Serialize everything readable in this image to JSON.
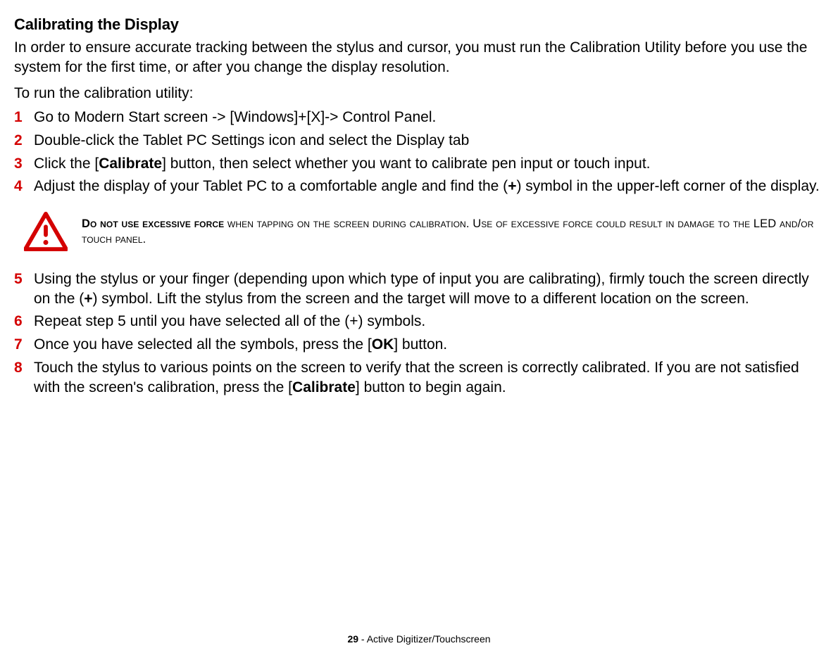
{
  "heading": "Calibrating the Display",
  "intro": "In order to ensure accurate tracking between the stylus and cursor, you must run the Calibration Utility before you use the system for the first time, or after you change the display resolution.",
  "lead": "To run the calibration utility:",
  "stepsA": {
    "n1": "1",
    "s1": "Go to Modern Start screen -> [Windows]+[X]-> Control Panel.",
    "n2": "2",
    "s2": "Double-click the Tablet PC Settings icon and select the Display tab",
    "n3": "3",
    "s3a": "Click the [",
    "s3b": "Calibrate",
    "s3c": "] button, then select whether you want to calibrate pen input or touch input.",
    "n4": "4",
    "s4a": "Adjust the display of your Tablet PC to a comfortable angle and find the (",
    "s4b": "+",
    "s4c": ") symbol in the upper-left corner of the display."
  },
  "warning": {
    "strong": "Do not use excessive force",
    "rest": " when tapping on the screen during calibration. Use of excessive force could result in damage to the LED and/or touch panel."
  },
  "stepsB": {
    "n5": "5",
    "s5a": "Using the stylus or your finger (depending upon which type of input you are calibrating), firmly touch the screen directly on the (",
    "s5b": "+",
    "s5c": ") symbol. Lift the stylus from the screen and the target will move to a different location on the screen.",
    "n6": "6",
    "s6": "Repeat step 5 until you have selected all of the (+) symbols.",
    "n7": "7",
    "s7a": "Once you have selected all the symbols, press the [",
    "s7b": "OK",
    "s7c": "] button.",
    "n8": "8",
    "s8a": "Touch the stylus to various points on the screen to verify that the screen is correctly calibrated. If you are not satisfied with the screen's calibration, press the [",
    "s8b": "Calibrate",
    "s8c": "] button to begin again."
  },
  "footer": {
    "page": "29",
    "sep": " - ",
    "section": "Active Digitizer/Touchscreen"
  }
}
